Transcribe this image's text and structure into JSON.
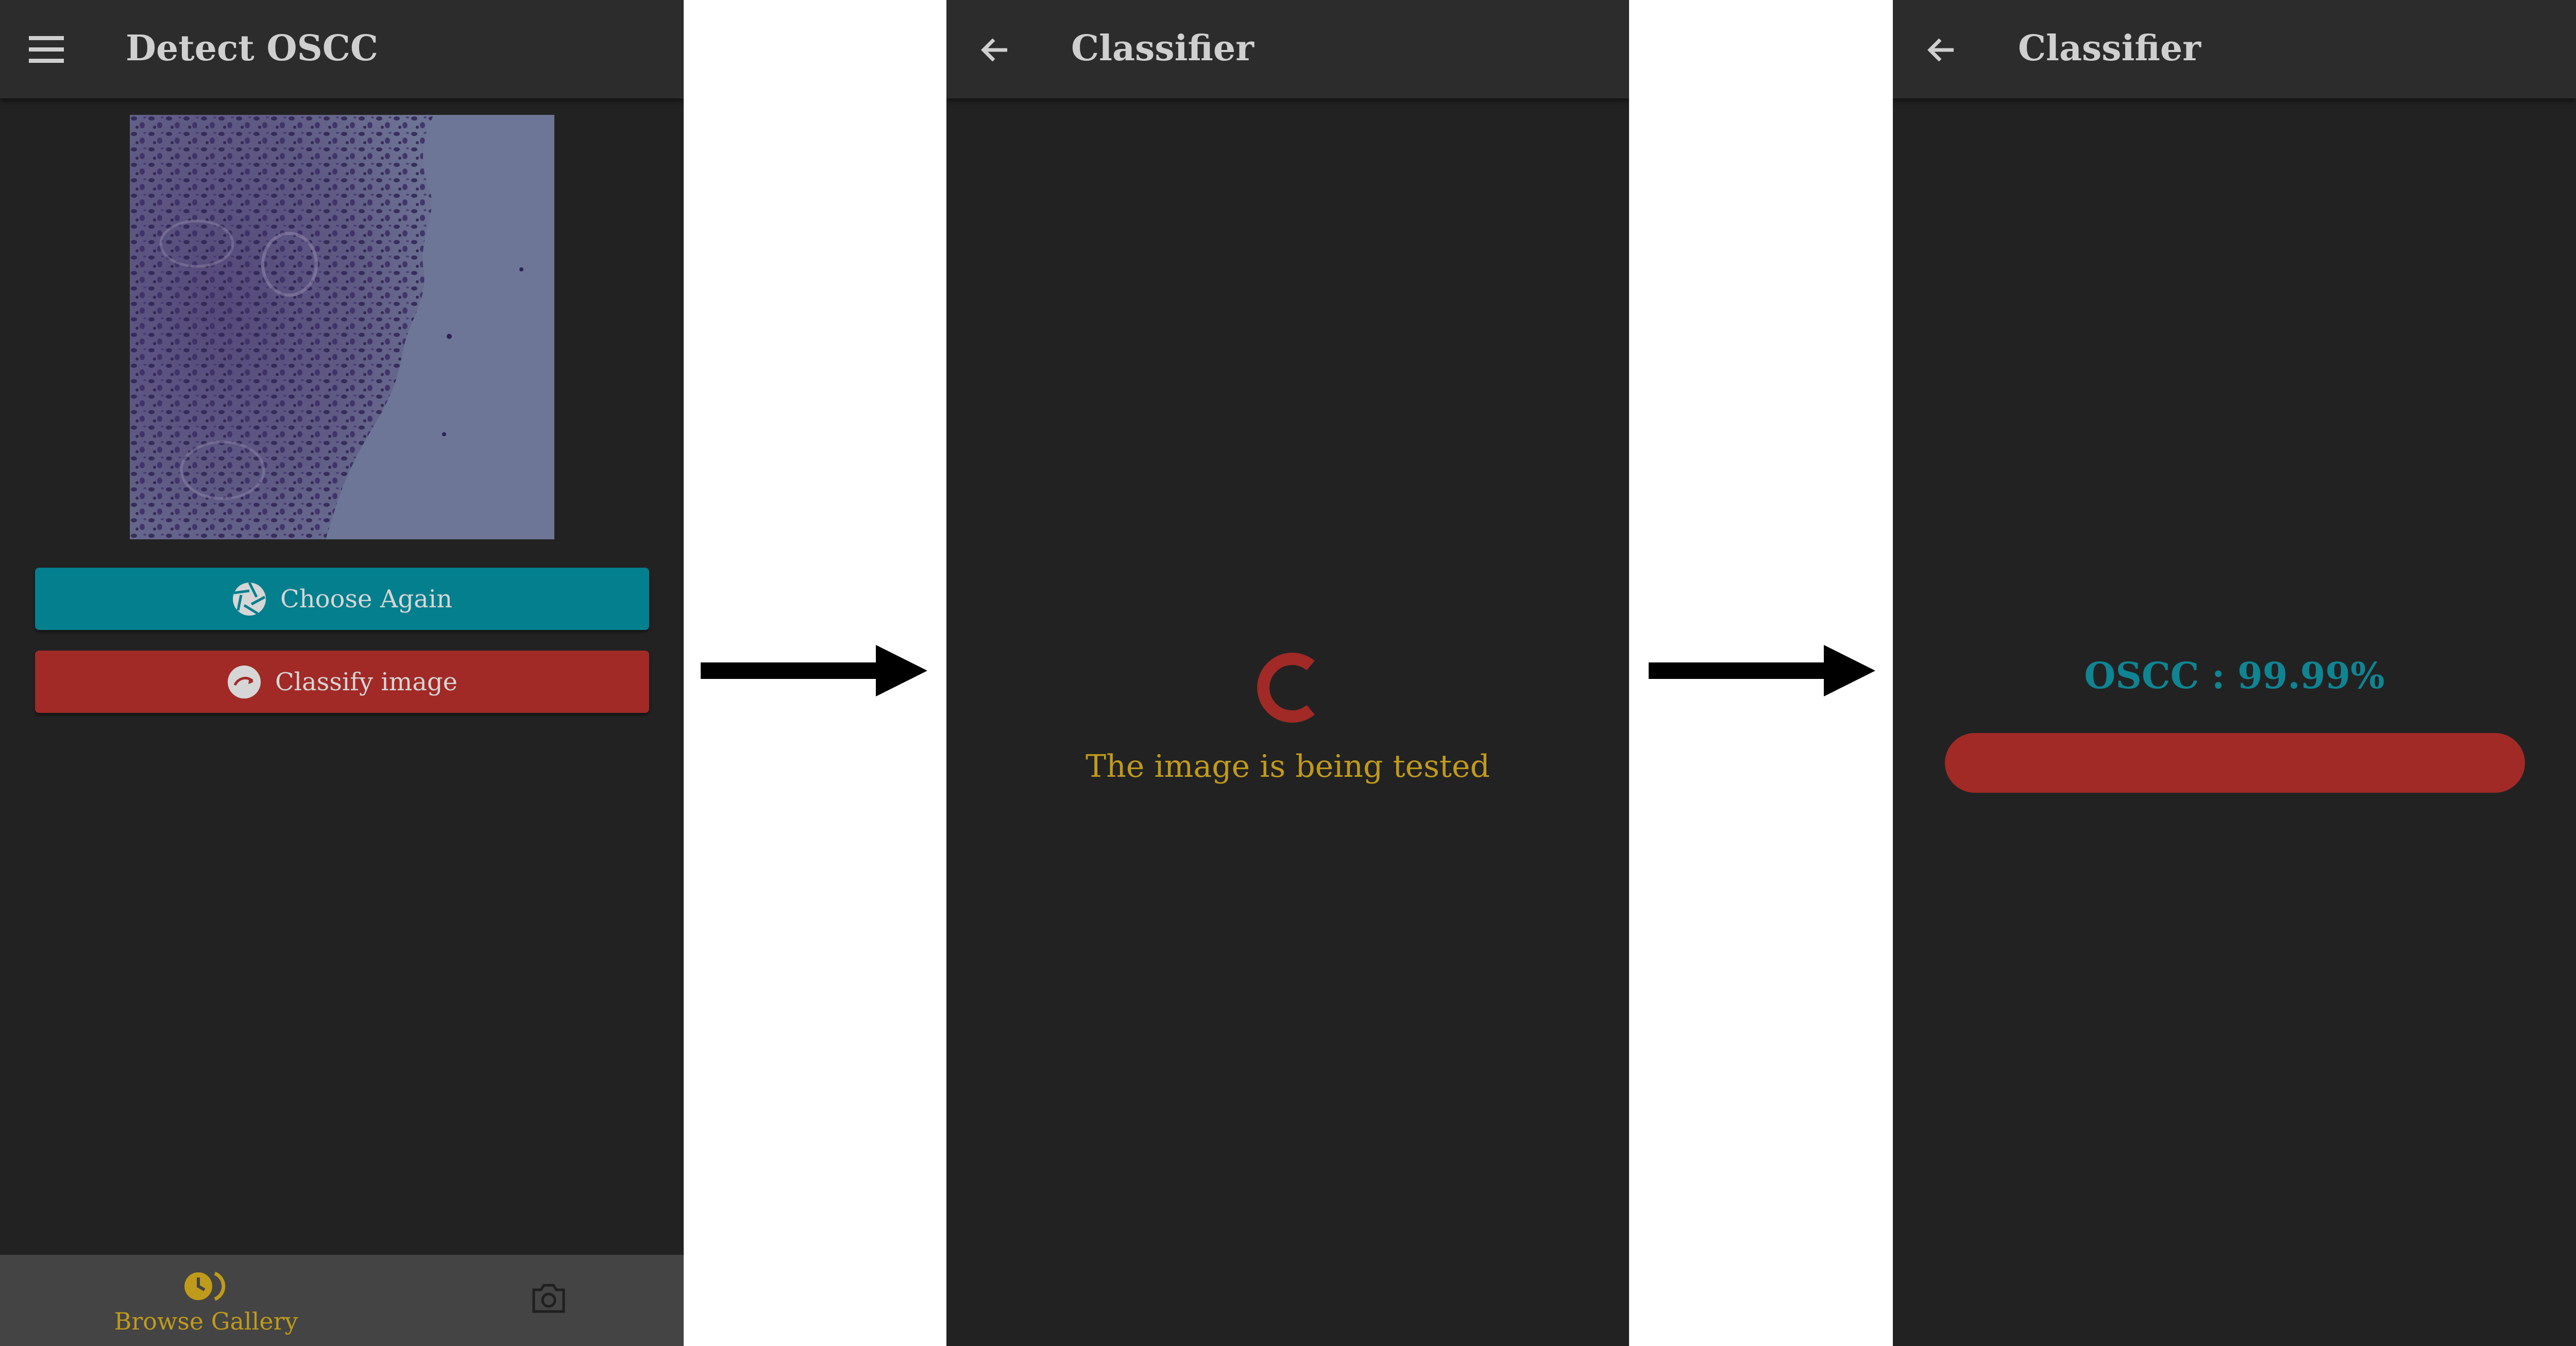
{
  "screen_detect": {
    "title": "Detect OSCC",
    "menu_icon": "menu-icon",
    "image_description_icon": "histology-image",
    "choose_again": {
      "label": "Choose Again",
      "icon": "aperture-icon",
      "color": "#047f8e"
    },
    "classify": {
      "label": "Classify image",
      "icon": "classify-icon",
      "color": "#a12a26"
    },
    "bottom_nav": {
      "gallery": {
        "label": "Browse Gallery",
        "icon": "gallery-icon",
        "active": true,
        "color": "#c09a1b"
      },
      "camera": {
        "icon": "camera-icon",
        "active": false
      }
    }
  },
  "screen_loading": {
    "title": "Classifier",
    "back_icon": "back-arrow-icon",
    "spinner_icon": "loading-spinner-icon",
    "message": "The image is being tested"
  },
  "screen_result": {
    "title": "Classifier",
    "back_icon": "back-arrow-icon",
    "result": "OSCC : 99.99%",
    "confidence_percent": 99.99,
    "bar_color": "#a12a26"
  },
  "transition_arrows": [
    "right-arrow-icon",
    "right-arrow-icon"
  ],
  "colors": {
    "background": "#222222",
    "appbar": "#2c2c2c",
    "accent_gold": "#c09a1b",
    "teal": "#0f8493",
    "red": "#a12a26"
  }
}
